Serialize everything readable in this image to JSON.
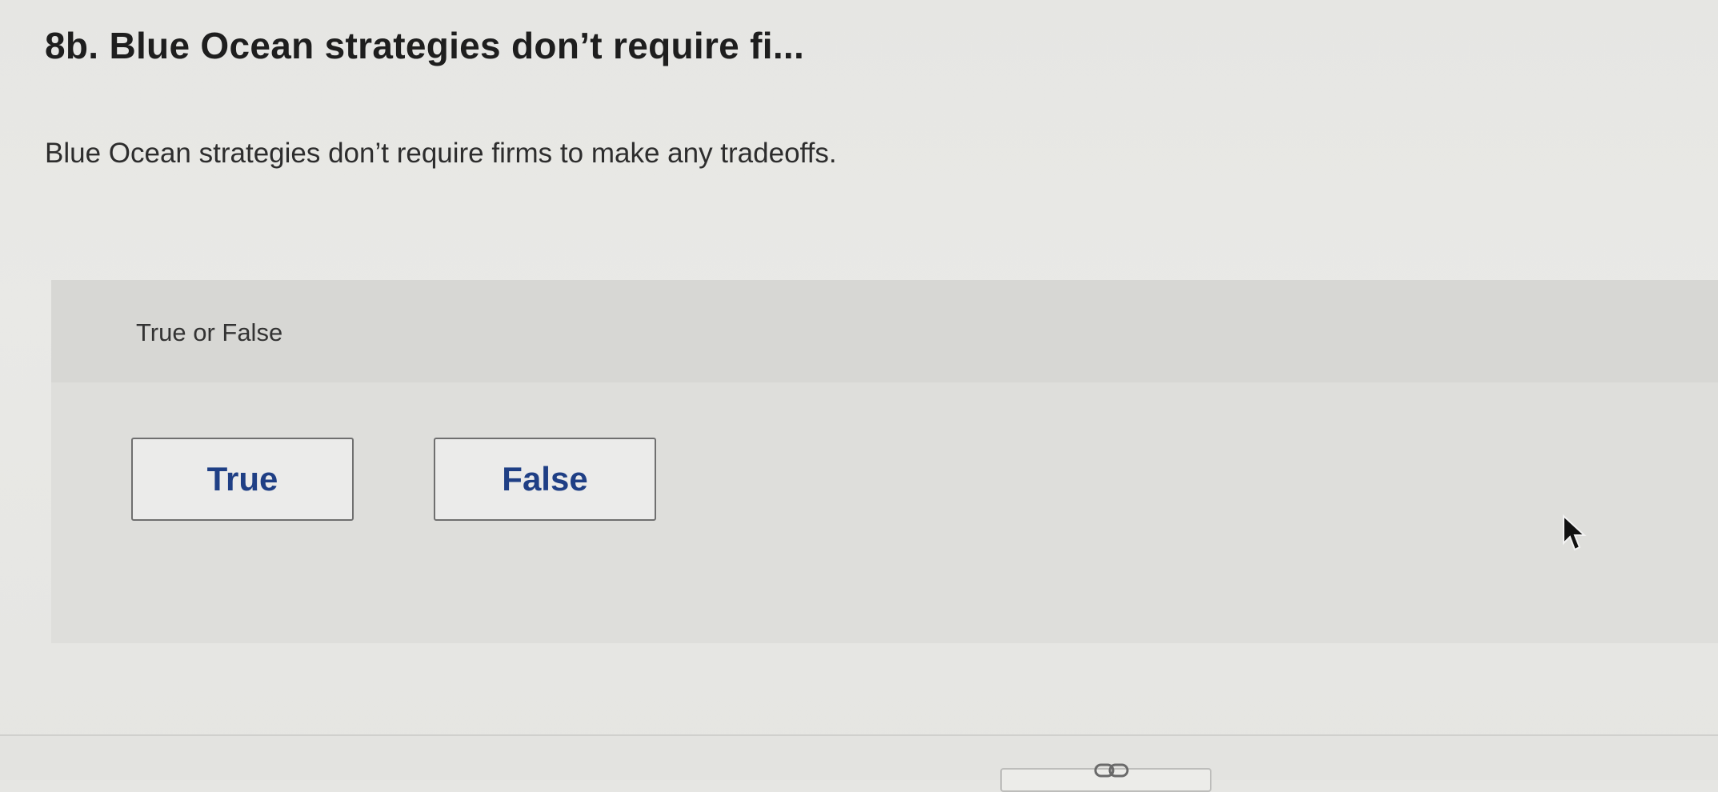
{
  "question": {
    "title": "8b. Blue Ocean strategies don’t require fi...",
    "prompt": "Blue Ocean strategies don’t require firms to make any tradeoffs."
  },
  "answer_panel": {
    "type_label": "True or False",
    "options": [
      "True",
      "False"
    ]
  },
  "icons": {
    "link": "link-icon",
    "pointer": "mouse-cursor-icon"
  },
  "colors": {
    "option_text": "#1f3f85",
    "panel_background": "#dededb"
  }
}
